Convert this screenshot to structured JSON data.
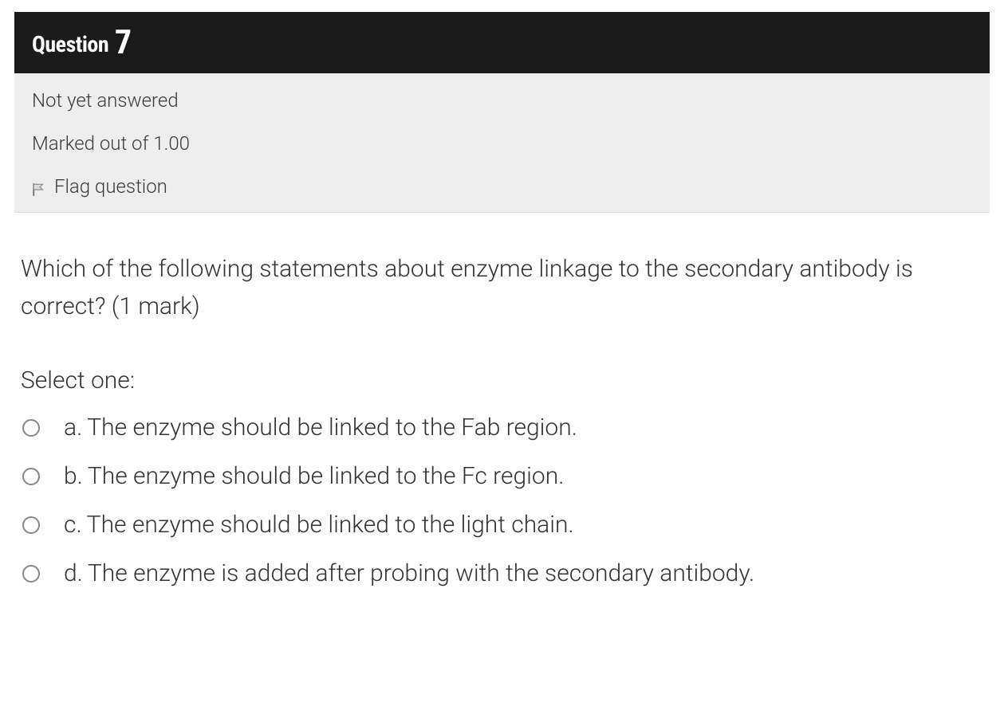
{
  "header": {
    "question_label": "Question",
    "question_number": "7"
  },
  "meta": {
    "status": "Not yet answered",
    "marks": "Marked out of 1.00",
    "flag_label": "Flag question"
  },
  "body": {
    "question_text": "Which of the following statements about enzyme linkage to the secondary antibody is correct? (1 mark)",
    "select_prompt": "Select one:",
    "options": [
      {
        "letter": "a.",
        "text": "The enzyme should be linked to the Fab region."
      },
      {
        "letter": "b.",
        "text": "The enzyme should be linked to the Fc region."
      },
      {
        "letter": "c.",
        "text": "The enzyme should be linked to the light chain."
      },
      {
        "letter": "d.",
        "text": "The enzyme is added after probing with the secondary antibody."
      }
    ]
  }
}
